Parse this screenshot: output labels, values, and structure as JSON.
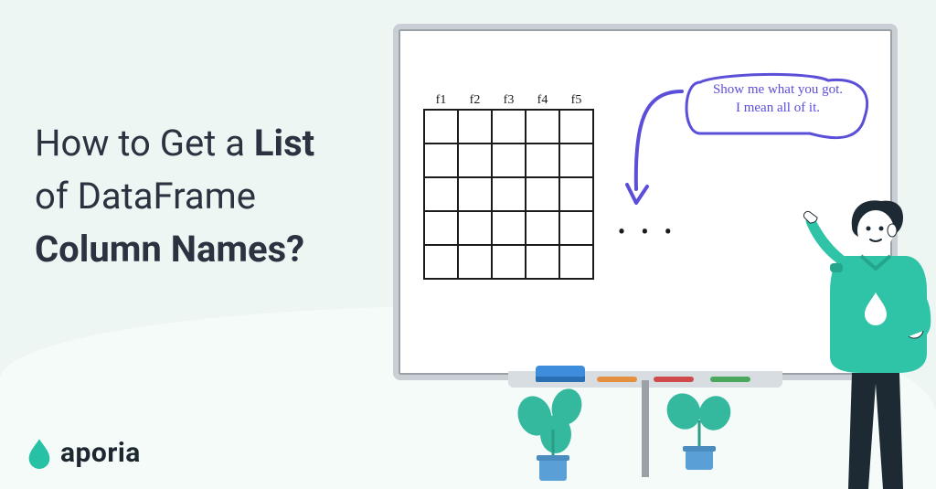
{
  "headline": {
    "part1": "How to Get a ",
    "bold1": "List",
    "part2": " of DataFrame ",
    "bold2": "Column Names?"
  },
  "logo": {
    "text": "aporia"
  },
  "whiteboard": {
    "columns": [
      "f1",
      "f2",
      "f3",
      "f4",
      "f5"
    ],
    "ellipsis": "• • •",
    "speech_line1": "Show me what you got.",
    "speech_line2": "I mean all of it."
  },
  "colors": {
    "accent": "#27c2a6",
    "ink": "#2b3340",
    "purple": "#5b4fd9"
  }
}
